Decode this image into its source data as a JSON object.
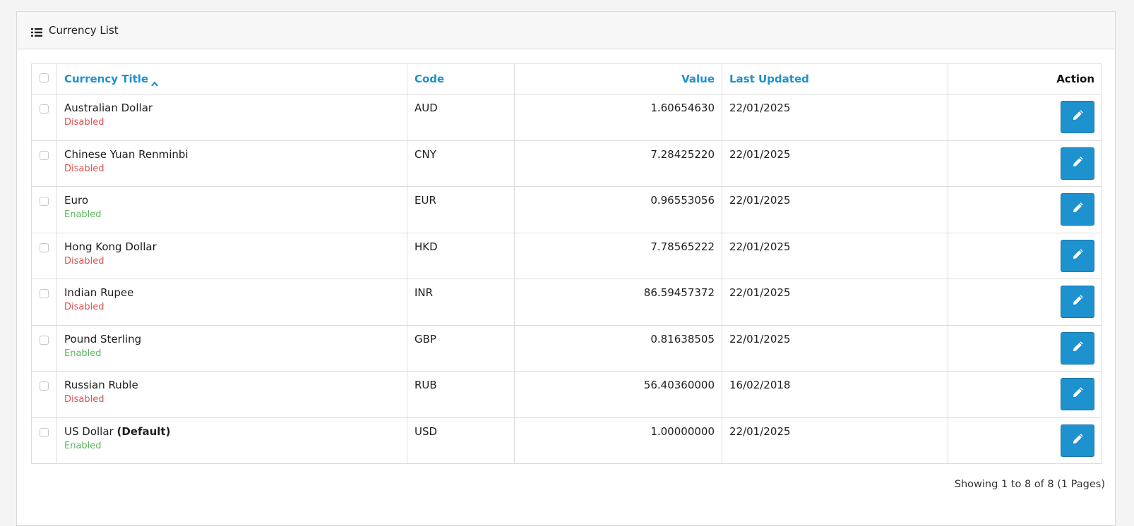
{
  "panel": {
    "title": "Currency List",
    "icon": "list-icon"
  },
  "table": {
    "headers": {
      "title": "Currency Title",
      "code": "Code",
      "value": "Value",
      "last_updated": "Last Updated",
      "action": "Action"
    },
    "sort": {
      "column": "title",
      "direction": "ascending"
    },
    "rows": [
      {
        "title": "Australian Dollar",
        "default": "",
        "status": "Disabled",
        "code": "AUD",
        "value": "1.60654630",
        "updated": "22/01/2025"
      },
      {
        "title": "Chinese Yuan Renminbi",
        "default": "",
        "status": "Disabled",
        "code": "CNY",
        "value": "7.28425220",
        "updated": "22/01/2025"
      },
      {
        "title": "Euro",
        "default": "",
        "status": "Enabled",
        "code": "EUR",
        "value": "0.96553056",
        "updated": "22/01/2025"
      },
      {
        "title": "Hong Kong Dollar",
        "default": "",
        "status": "Disabled",
        "code": "HKD",
        "value": "7.78565222",
        "updated": "22/01/2025"
      },
      {
        "title": "Indian Rupee",
        "default": "",
        "status": "Disabled",
        "code": "INR",
        "value": "86.59457372",
        "updated": "22/01/2025"
      },
      {
        "title": "Pound Sterling",
        "default": "",
        "status": "Enabled",
        "code": "GBP",
        "value": "0.81638505",
        "updated": "22/01/2025"
      },
      {
        "title": "Russian Ruble",
        "default": "",
        "status": "Disabled",
        "code": "RUB",
        "value": "56.40360000",
        "updated": "16/02/2018"
      },
      {
        "title": "US Dollar",
        "default": "(Default)",
        "status": "Enabled",
        "code": "USD",
        "value": "1.00000000",
        "updated": "22/01/2025"
      }
    ]
  },
  "pagination": {
    "text": "Showing 1 to 8 of 8 (1 Pages)"
  },
  "colors": {
    "accent": "#1e91cf",
    "disabled": "#d9534f",
    "enabled": "#5cb85c"
  }
}
